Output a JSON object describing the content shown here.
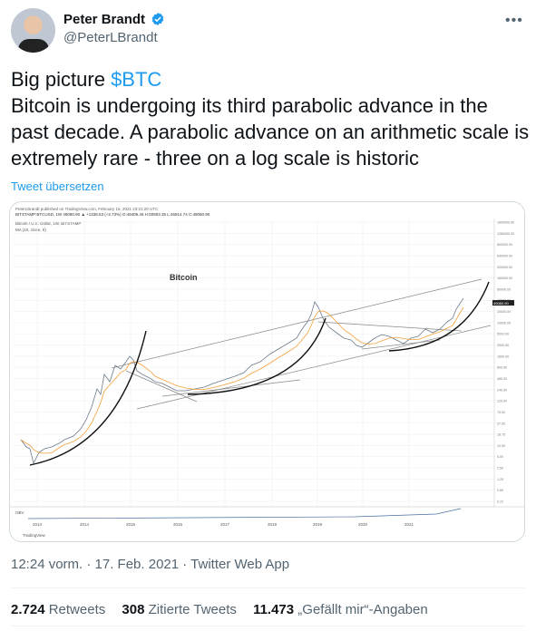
{
  "author": {
    "name": "Peter Brandt",
    "handle": "@PeterLBrandt"
  },
  "tweet": {
    "line1_prefix": "Big picture ",
    "cashtag": "$BTC",
    "body": "Bitcoin is undergoing its third parabolic advance in the past decade. A parabolic advance on an arithmetic scale is extremely rare - three on a log scale is historic",
    "translate_label": "Tweet übersetzen",
    "timestamp": "12:24 vorm. · 17. Feb. 2021 · Twitter Web App"
  },
  "stats": {
    "retweets": "2.724",
    "retweets_label": "Retweets",
    "quotes": "308",
    "quotes_label": "Zitierte Tweets",
    "likes": "11.473",
    "likes_label": "„Gefällt mir“-Angaben"
  },
  "chart": {
    "header_line1": "PeterLBrandt published on TradingView.com, February 16, 2021 23:21:20 UTC",
    "header_line2": "BITSTAMP:BTCUSD, 1W 49080.90 ▲ +1338.53 (+2.73%) O:49409.46 H:50903.35 L:46914.74 C:49080.90",
    "series_info": "Bitcoin / U.S. Dollar, 1W, BITSTAMP",
    "ma_info": "MA (10, close, 0)",
    "annotation": "Bitcoin",
    "obv_label": "OBV",
    "footer_brand": "TradingView",
    "price_tag": "49080.90",
    "y_ticks": [
      "1600000.00",
      "1280000.00",
      "800000.00",
      "640000.00",
      "320000.00",
      "160000.00",
      "80000.00",
      "40000.00",
      "20000.00",
      "10000.00",
      "5000.00",
      "2500.00",
      "1600.00",
      "800.00",
      "480.00",
      "240.00",
      "120.00",
      "75.00",
      "37.50",
      "18.75",
      "10.00",
      "5.00",
      "2.50",
      "1.25",
      "0.60",
      "0.22"
    ],
    "x_ticks": [
      "2013",
      "2014",
      "2015",
      "2016",
      "2017",
      "2018",
      "2019",
      "2020",
      "2021"
    ],
    "accent_orange": "#f5a03a",
    "price_color": "#6d7b8c"
  }
}
